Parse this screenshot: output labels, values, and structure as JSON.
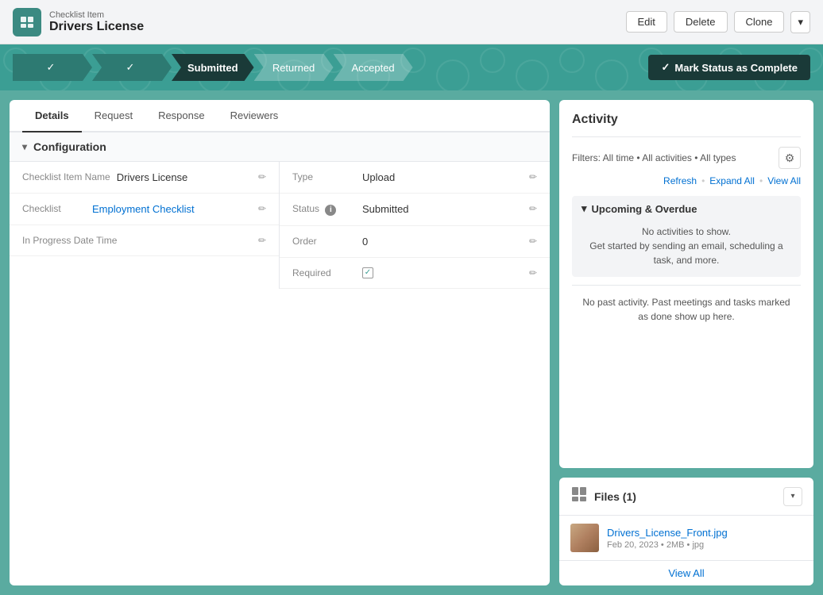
{
  "header": {
    "icon": "☰",
    "title_small": "Checklist Item",
    "title_large": "Drivers License",
    "buttons": {
      "edit": "Edit",
      "delete": "Delete",
      "clone": "Clone",
      "dropdown_aria": "More actions"
    }
  },
  "status_bar": {
    "steps": [
      {
        "id": "step1",
        "label": "",
        "type": "complete",
        "check": "✓"
      },
      {
        "id": "step2",
        "label": "",
        "type": "complete",
        "check": "✓"
      },
      {
        "id": "step3",
        "label": "Submitted",
        "type": "active"
      },
      {
        "id": "step4",
        "label": "Returned",
        "type": "inactive"
      },
      {
        "id": "step5",
        "label": "Accepted",
        "type": "inactive"
      }
    ],
    "mark_complete_button": "Mark Status as Complete",
    "check_icon": "✓"
  },
  "left_panel": {
    "tabs": [
      {
        "id": "details",
        "label": "Details",
        "active": true
      },
      {
        "id": "request",
        "label": "Request",
        "active": false
      },
      {
        "id": "response",
        "label": "Response",
        "active": false
      },
      {
        "id": "reviewers",
        "label": "Reviewers",
        "active": false
      }
    ],
    "section_title": "Configuration",
    "fields_left": [
      {
        "label": "Checklist Item Name",
        "value": "Drivers License",
        "link": false
      },
      {
        "label": "Checklist",
        "value": "Employment Checklist",
        "link": true
      },
      {
        "label": "In Progress Date Time",
        "value": "",
        "link": false
      }
    ],
    "fields_right": [
      {
        "label": "Type",
        "value": "Upload",
        "link": false
      },
      {
        "label": "Status",
        "value": "Submitted",
        "link": false,
        "info": true
      },
      {
        "label": "Order",
        "value": "0",
        "link": false
      },
      {
        "label": "Required",
        "value": "checkbox",
        "link": false
      }
    ]
  },
  "right_panel": {
    "activity": {
      "title": "Activity",
      "filters_label": "Filters: All time • All activities • All types",
      "refresh": "Refresh",
      "expand_all": "Expand All",
      "view_all": "View All",
      "upcoming_title": "Upcoming & Overdue",
      "upcoming_empty_line1": "No activities to show.",
      "upcoming_empty_line2": "Get started by sending an email, scheduling a",
      "upcoming_empty_line3": "task, and more.",
      "no_past_line1": "No past activity. Past meetings and tasks marked",
      "no_past_line2": "as done show up here."
    },
    "files": {
      "title": "Files (1)",
      "file_name": "Drivers_License_Front.jpg",
      "file_date": "Feb 20, 2023",
      "file_size": "2MB",
      "file_type": "jpg",
      "view_all": "View All"
    }
  }
}
